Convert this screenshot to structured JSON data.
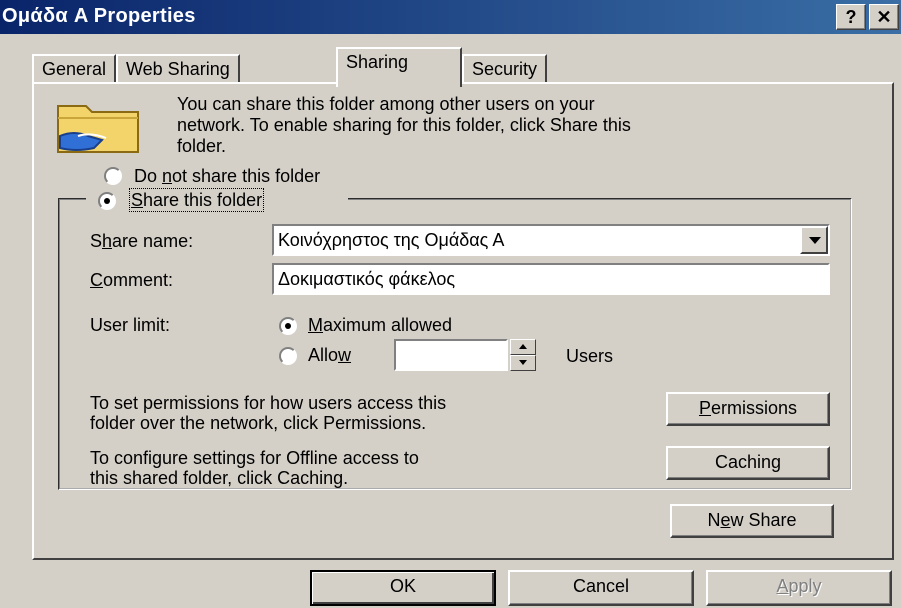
{
  "window": {
    "title": "Ομάδα A Properties",
    "help_label": "?",
    "close_label": "✕"
  },
  "tabs": [
    {
      "label": "General"
    },
    {
      "label": "Web Sharing"
    },
    {
      "label": "Sharing"
    },
    {
      "label": "Security"
    }
  ],
  "active_tab": "Sharing",
  "intro": {
    "line1": "You can share this folder among other users on your",
    "line2": "network.  To enable sharing for this folder, click Share this",
    "line3": "folder.",
    "icon": "shared-folder-icon"
  },
  "share_options": {
    "do_not_share": {
      "pre": "Do ",
      "acc": "n",
      "post": "ot share this folder",
      "selected": false
    },
    "share": {
      "pre": "",
      "acc": "S",
      "post": "hare this folder",
      "selected": true
    }
  },
  "share_name": {
    "label_pre": "S",
    "label_acc": "h",
    "label_post": "are name:",
    "value": "Κοινόχρηστος της Ομάδας Α"
  },
  "comment": {
    "label_acc": "C",
    "label_post": "omment:",
    "value": "Δοκιμαστικός φάκελος"
  },
  "user_limit": {
    "label": "User limit:",
    "maximum": {
      "acc": "M",
      "post": "aximum allowed",
      "selected": true
    },
    "allow": {
      "pre": "Allo",
      "acc": "w",
      "selected": false,
      "value": ""
    },
    "users_label": "Users"
  },
  "permissions": {
    "line1": "To set permissions for how users access this",
    "line2": "folder over the network, click Permissions.",
    "button_acc": "P",
    "button_post": "ermissions"
  },
  "caching": {
    "line1": "To configure settings for Offline access to",
    "line2": "this shared folder, click Caching.",
    "button_label": "Caching"
  },
  "new_share": {
    "pre": "N",
    "acc": "e",
    "post": "w Share"
  },
  "footer": {
    "ok": "OK",
    "cancel": "Cancel",
    "apply_acc": "A",
    "apply_post": "pply"
  }
}
